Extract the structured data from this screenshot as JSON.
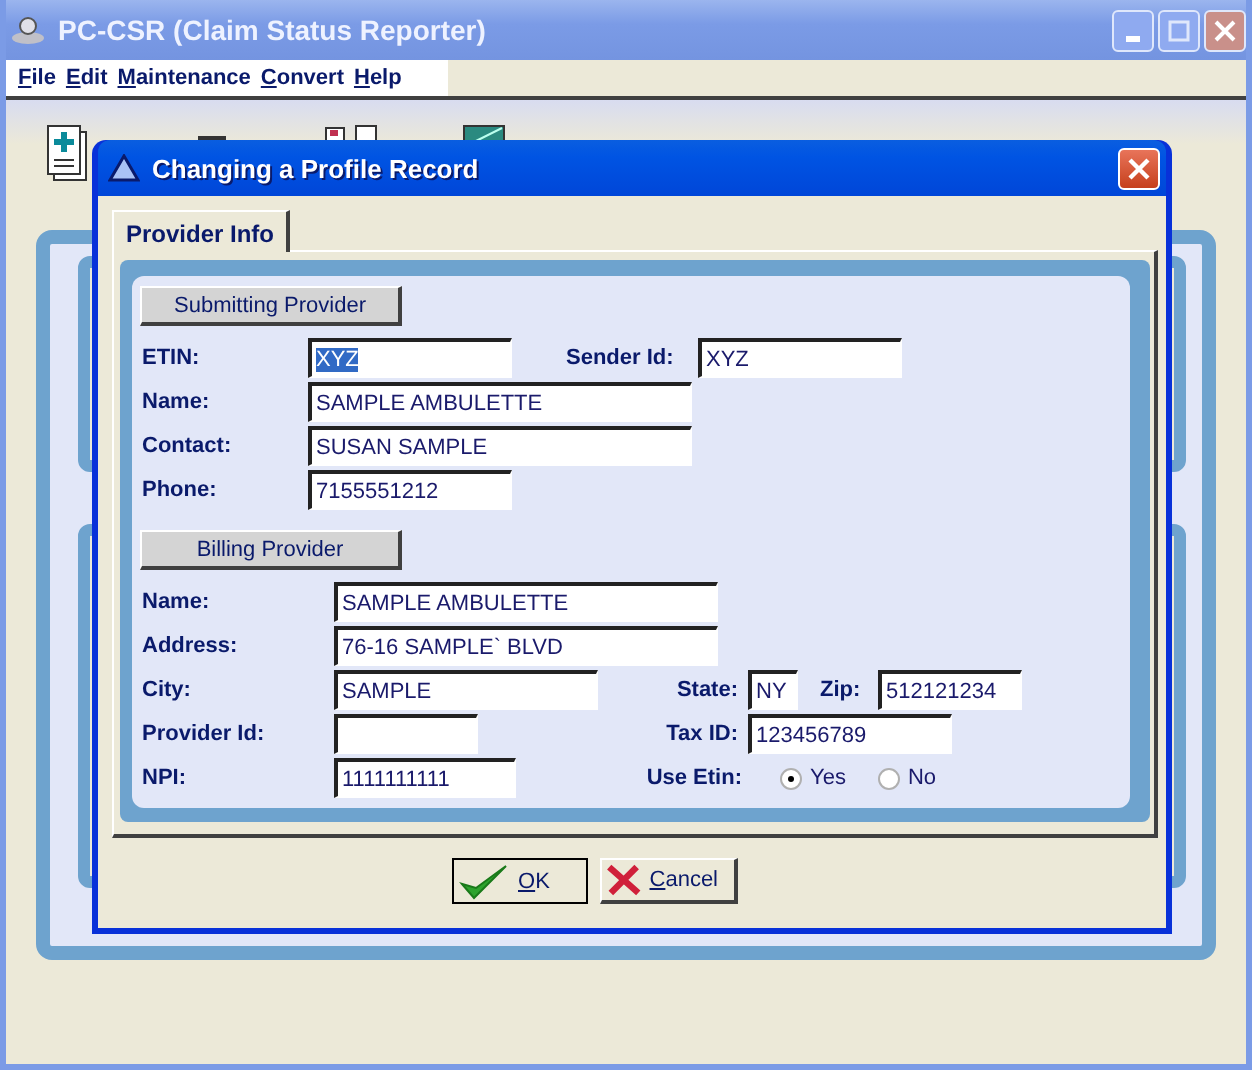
{
  "window": {
    "title": "PC-CSR (Claim Status Reporter)"
  },
  "menu": [
    {
      "label": "File"
    },
    {
      "label": "Edit"
    },
    {
      "label": "Maintenance"
    },
    {
      "label": "Convert"
    },
    {
      "label": "Help"
    }
  ],
  "dialog": {
    "title": "Changing a Profile Record",
    "tabs": [
      {
        "label": "Provider Info",
        "selected": true
      }
    ],
    "sections": [
      {
        "heading": "Submitting Provider",
        "rows": [
          [
            {
              "kind": "text",
              "label": "ETIN:",
              "value": "XYZ",
              "focused": true
            },
            {
              "kind": "text",
              "label": "Sender Id:",
              "value": "XYZ",
              "focused": false
            }
          ],
          [
            {
              "kind": "text",
              "label": "Name:",
              "value": "SAMPLE AMBULETTE",
              "focused": false
            }
          ],
          [
            {
              "kind": "text",
              "label": "Contact:",
              "value": "SUSAN SAMPLE",
              "focused": false
            }
          ],
          [
            {
              "kind": "text",
              "label": "Phone:",
              "value": "7155551212",
              "focused": false
            }
          ]
        ]
      },
      {
        "heading": "Billing Provider",
        "rows": [
          [
            {
              "kind": "text",
              "label": "Name:",
              "value": "SAMPLE AMBULETTE",
              "focused": false
            }
          ],
          [
            {
              "kind": "text",
              "label": "Address:",
              "value": "76-16 SAMPLE` BLVD",
              "focused": false
            }
          ],
          [
            {
              "kind": "text",
              "label": "City:",
              "value": "SAMPLE",
              "focused": false
            },
            {
              "kind": "text",
              "label": "State:",
              "value": "NY",
              "focused": false
            },
            {
              "kind": "text",
              "label": "Zip:",
              "value": "512121234",
              "focused": false
            }
          ],
          [
            {
              "kind": "text",
              "label": "Provider Id:"
            },
            {
              "kind": "text",
              "label": "Tax ID:",
              "value": "123456789",
              "focused": false
            }
          ],
          [
            {
              "kind": "text",
              "label": "NPI:",
              "value": "1111111111",
              "focused": false
            },
            {
              "kind": "radio",
              "label": "Use Etin:",
              "options": [
                {
                  "label": "Yes",
                  "selected": true
                },
                {
                  "label": "No",
                  "selected": false
                }
              ]
            }
          ]
        ]
      }
    ],
    "buttons": [
      {
        "kind": "ok",
        "label": "OK"
      },
      {
        "kind": "cancel",
        "label": "Cancel"
      }
    ]
  }
}
